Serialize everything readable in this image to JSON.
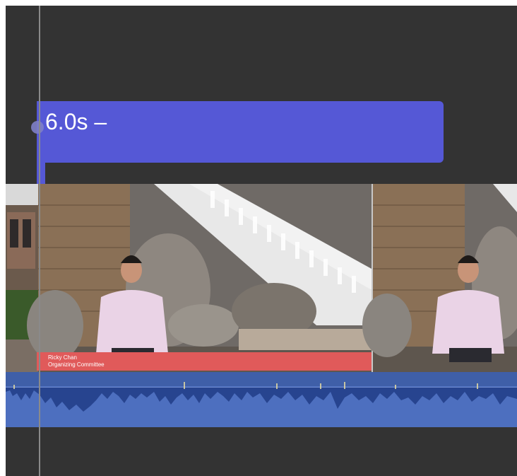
{
  "caption_clip": {
    "label": "6.0s –",
    "color": "#5558d6"
  },
  "lower_third": {
    "name": "Ricky Chan",
    "role": "Organizing Committee",
    "color": "#e05a5a"
  },
  "tracks": {
    "audio_color": "#4d6fbf",
    "background": "#333333"
  }
}
